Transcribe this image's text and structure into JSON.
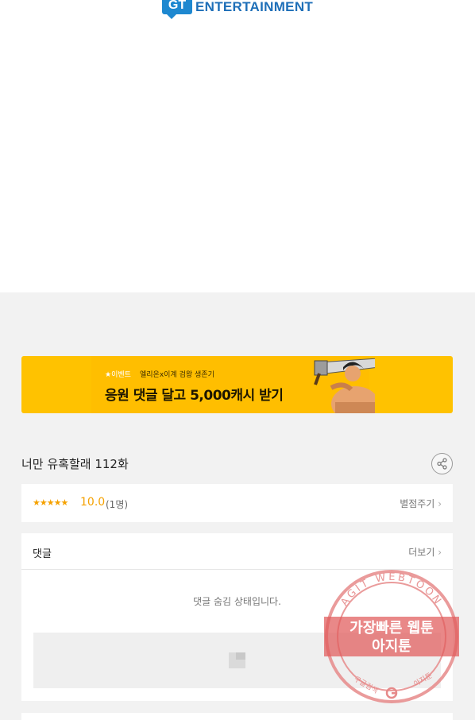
{
  "logo": {
    "badge": "GT",
    "text": "ENTERTAINMENT"
  },
  "banner": {
    "tag": "★이벤트",
    "subtitle": "엘리온x이계 검왕 생존기",
    "title": "응원 댓글 달고 5,000캐시 받기"
  },
  "episode": {
    "title": "너만 유혹할래 112화"
  },
  "rating": {
    "stars": "★★★★★",
    "score": "10.0",
    "count": "(1명)",
    "rate_label": "별점주기"
  },
  "comments": {
    "label": "댓글",
    "more_label": "더보기",
    "hidden_message": "댓글 숨김 상태입니다."
  },
  "watermark": {
    "ring_text": "AGIT WEBTOON",
    "line1": "가장빠른 웹툰",
    "line2": "아지툰",
    "bottom_left": "구글검색",
    "bottom_right": "아지툰"
  },
  "colors": {
    "banner_bg": "#ffc200",
    "star": "#f5a100",
    "logo_blue": "#1e88d0",
    "watermark_red": "#e05a5a"
  },
  "icons": [
    "share-icon",
    "chevron-right-icon",
    "placeholder-image-icon",
    "google-icon"
  ]
}
